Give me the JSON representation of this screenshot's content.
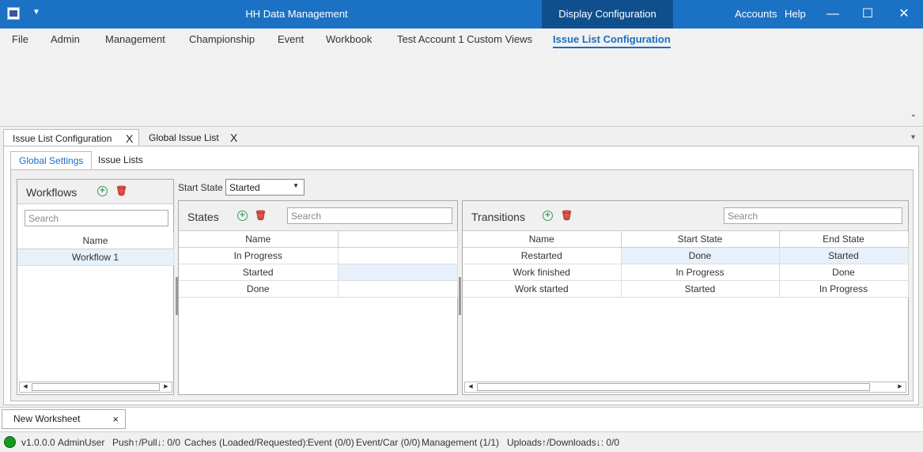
{
  "window": {
    "title": "HH Data Management",
    "display_config": "Display Configuration",
    "accounts": "Accounts",
    "help": "Help",
    "qa_toolbar": "▼",
    "minimize": "—",
    "maximize": "☐",
    "close": "✕"
  },
  "menu": {
    "items": [
      "File",
      "Admin",
      "Management",
      "Championship",
      "Event",
      "Workbook",
      "Test Account 1 Custom Views",
      "Issue List Configuration"
    ],
    "active": "Issue List Configuration",
    "collapse": "⌃"
  },
  "doc_tabs": [
    {
      "label": "Issue List Configuration",
      "close": "X"
    },
    {
      "label": "Global Issue List",
      "close": "X"
    }
  ],
  "doc_tabs_dropdown": "▼",
  "inner_tabs": [
    "Global Settings",
    "Issue Lists"
  ],
  "workflows": {
    "title": "Workflows",
    "search_placeholder": "Search",
    "columns": [
      "Name"
    ],
    "rows": [
      "Workflow 1"
    ]
  },
  "start_state": {
    "label": "Start State",
    "value": "Started"
  },
  "states": {
    "title": "States",
    "search_placeholder": "Search",
    "columns": [
      "Name",
      ""
    ],
    "rows": [
      "In Progress",
      "Started",
      "Done"
    ]
  },
  "transitions": {
    "title": "Transitions",
    "search_placeholder": "Search",
    "columns": [
      "Name",
      "Start State",
      "End State"
    ],
    "rows": [
      [
        "Restarted",
        "Done",
        "Started"
      ],
      [
        "Work finished",
        "In Progress",
        "Done"
      ],
      [
        "Work started",
        "Started",
        "In Progress"
      ]
    ]
  },
  "icons": {
    "add": "add-icon",
    "delete": "delete-icon"
  },
  "worksheet_tab": {
    "label": "New Worksheet",
    "close": "×"
  },
  "status": {
    "version": "v1.0.0.0",
    "user": "AdminUser",
    "push_pull": "Push↑/Pull↓: 0/0",
    "caches": "Caches (Loaded/Requested):",
    "event": "Event (0/0)",
    "event_car": "Event/Car (0/0)",
    "management": "Management (1/1)",
    "uploads": "Uploads↑/Downloads↓: 0/0"
  }
}
